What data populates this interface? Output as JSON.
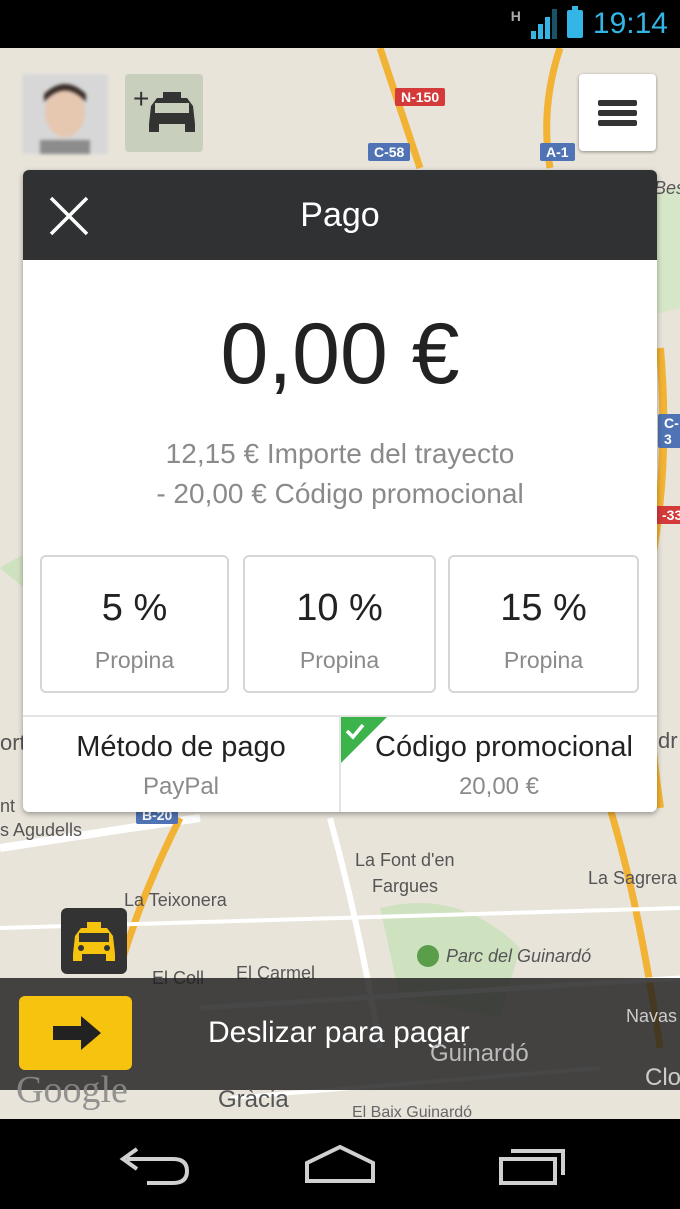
{
  "status_bar": {
    "network": "H",
    "time": "19:14"
  },
  "map": {
    "labels": {
      "la_font": "La Font d'en",
      "fargues": "Fargues",
      "la_teixonera": "La Teixonera",
      "el_coll": "El Coll",
      "el_carmel": "El Carmel",
      "parc": "Parc del Guinardó",
      "la_sagrera": "La Sagrera",
      "navas": "Navas",
      "guinardo": "Guinardó",
      "clot": "Clo",
      "gracia": "Gràcia",
      "el_baix": "El Baix Guinardó",
      "agudells": "s Agudells",
      "ort": "ort",
      "nt": "nt",
      "bes": "Bes",
      "dr": "dr"
    },
    "roads": {
      "n150": "N-150",
      "c58": "C-58",
      "a1": "A-1",
      "b20": "B-20",
      "c3": "C-3",
      "r33": "-33"
    },
    "attribution": "Google"
  },
  "payment": {
    "title": "Pago",
    "amount": "0,00 €",
    "trip_line": "12,15 € Importe del trayecto",
    "promo_line": "- 20,00 € Código promocional",
    "tips": [
      {
        "percent": "5 %",
        "label": "Propina"
      },
      {
        "percent": "10 %",
        "label": "Propina"
      },
      {
        "percent": "15 %",
        "label": "Propina"
      }
    ],
    "method": {
      "title": "Método de pago",
      "value": "PayPal"
    },
    "promo": {
      "title": "Código promocional",
      "value": "20,00 €"
    }
  },
  "slider": {
    "label": "Deslizar para pagar"
  },
  "colors": {
    "accent": "#f6c40f",
    "header": "#2f3133",
    "status": "#33b5e5",
    "check": "#3cb44b"
  }
}
